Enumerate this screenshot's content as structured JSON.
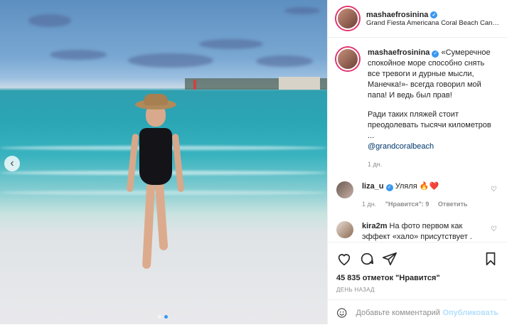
{
  "header": {
    "username": "mashaefrosinina",
    "location": "Grand Fiesta Americana Coral Beach Cancún ..."
  },
  "caption": {
    "username": "mashaefrosinina",
    "text": "«Сумеречное спокойное море способно снять все тревоги и дурные мысли, Манечка!»- всегда говорил мой папа! И ведь был прав!",
    "text2": "Ради таких пляжей стоит преодолевать тысячи километров ...",
    "mention": "@grandcoralbeach",
    "time": "1 дн."
  },
  "comments": [
    {
      "username": "liza_u",
      "text": "Уляля 🔥❤️",
      "time": "1 дн.",
      "likes": "\"Нравится\": 9",
      "reply": "Ответить"
    },
    {
      "username": "kira2m",
      "text": "На фото первом как эффект «хало» присутствует . Прям вокруг сияние",
      "time": "",
      "likes": "",
      "reply": ""
    }
  ],
  "actions": {
    "likes_text": "45 835 отметок \"Нравится\"",
    "date": "ДЕНЬ НАЗАД"
  },
  "add_comment": {
    "placeholder": "Добавьте комментарий...",
    "post_label": "Опубликовать"
  },
  "icons": {
    "like": "heart-icon",
    "comment": "comment-icon",
    "share": "share-icon",
    "save": "bookmark-icon",
    "prev": "chevron-left-icon",
    "emoji": "emoji-icon"
  },
  "colors": {
    "verified": "#3897f0",
    "link": "#00376b",
    "post_disabled": "#b2dffc"
  }
}
